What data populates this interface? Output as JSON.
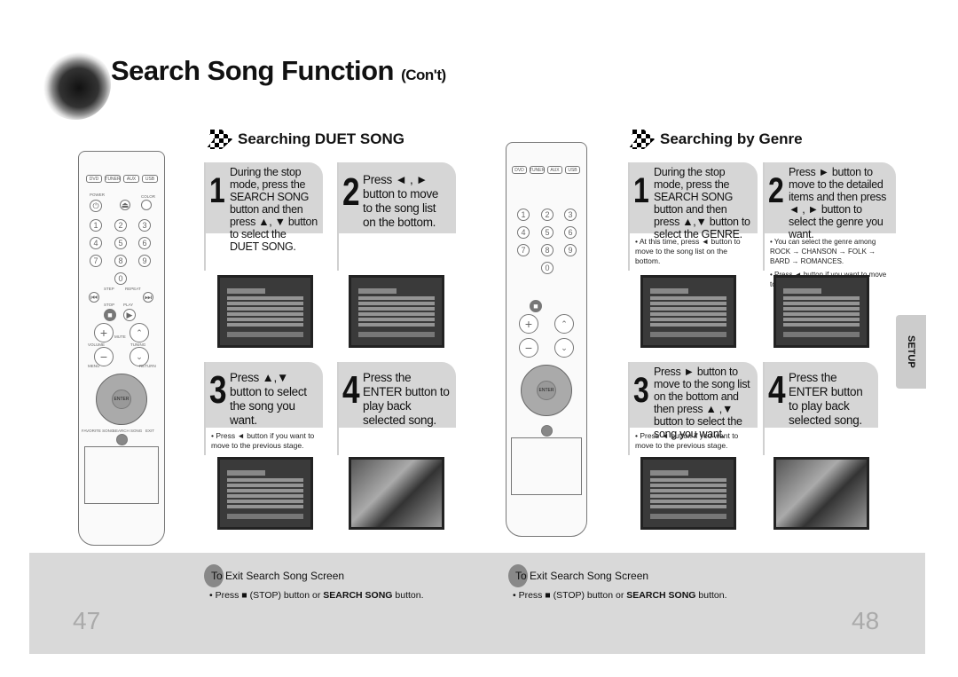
{
  "title": {
    "main": "Search Song Function",
    "suffix": "(Con't)"
  },
  "left": {
    "heading": "Searching DUET SONG",
    "steps": [
      {
        "num": "1",
        "text": "During the stop mode, press the SEARCH SONG button and then press ▲, ▼ button to select the DUET SONG."
      },
      {
        "num": "2",
        "text": "Press ◄ , ► button to move to the song list on the bottom."
      },
      {
        "num": "3",
        "text": "Press ▲,▼ button to select the song you want."
      },
      {
        "num": "4",
        "text": "Press the ENTER button to play back selected song."
      }
    ],
    "note3": "• Press ◄ button if you want to move to the previous stage."
  },
  "right": {
    "heading": "Searching by Genre",
    "steps": [
      {
        "num": "1",
        "text": "During the stop mode, press the SEARCH SONG button and then press ▲,▼ button to select the GENRE."
      },
      {
        "num": "2",
        "text": "Press ► button to move to the detailed items and then press ◄ , ► button to select the genre you want."
      },
      {
        "num": "3",
        "text": "Press ► button to move to the song list on the bottom and then press ▲ ,▼ button to select the song you want."
      },
      {
        "num": "4",
        "text": "Press the ENTER button to play back selected song."
      }
    ],
    "note1": "• At this time, press ◄ button to move to the song list on the bottom.",
    "note2a": "• You can select the genre among ROCK → CHANSON → FOLK → BARD → ROMANCES.",
    "note2b": "• Press ◄ button if you want to move to the previous stage.",
    "note3": "• Press ◄ button if you want to move to the previous stage."
  },
  "remote": {
    "dvd": "DVD",
    "tuner": "TUNER",
    "aux": "AUX",
    "usb": "USB",
    "power": "POWER",
    "color": "COLOR",
    "stop": "STOP",
    "play": "PLAY",
    "step": "STEP",
    "repeat": "REPEAT",
    "volume": "VOLUME",
    "tuning": "TUNING",
    "mute": "MUTE",
    "menu": "MENU",
    "return": "RETURN",
    "enter": "ENTER",
    "favorite": "FAVORITE SONG",
    "search": "SEARCH SONG",
    "exit": "EXIT",
    "digits": [
      "1",
      "2",
      "3",
      "4",
      "5",
      "6",
      "7",
      "8",
      "9",
      "0"
    ]
  },
  "setup_tab": "SETUP",
  "footer": {
    "exit_heading": "To Exit Search Song Screen",
    "exit_text_pre": "• Press ■ (STOP) button or ",
    "exit_text_bold": "SEARCH SONG",
    "exit_text_post": " button.",
    "page_left": "47",
    "page_right": "48"
  }
}
